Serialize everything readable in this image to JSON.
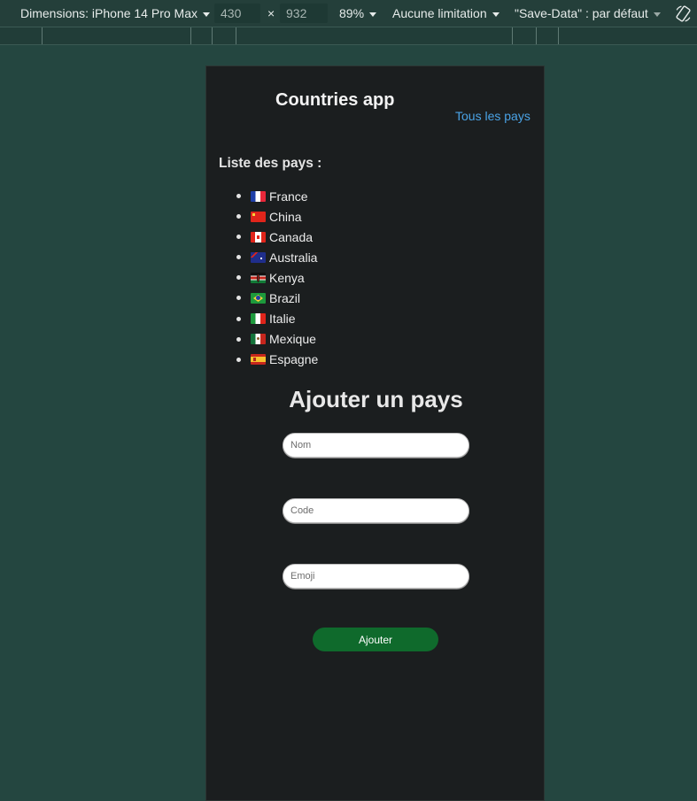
{
  "devtools": {
    "device_label": "Dimensions: iPhone 14 Pro Max",
    "width": "430",
    "times": "×",
    "height": "932",
    "zoom": "89%",
    "throttle": "Aucune limitation",
    "save_data": "\"Save-Data\" : par défaut",
    "rotate_icon": "rotate-icon"
  },
  "app": {
    "title": "Countries app",
    "nav_link": "Tous les pays",
    "list_title": "Liste des pays :",
    "countries": [
      {
        "name": "France",
        "flag": "france-flag-icon"
      },
      {
        "name": "China",
        "flag": "china-flag-icon"
      },
      {
        "name": "Canada",
        "flag": "canada-flag-icon"
      },
      {
        "name": "Australia",
        "flag": "australia-flag-icon"
      },
      {
        "name": "Kenya",
        "flag": "kenya-flag-icon"
      },
      {
        "name": "Brazil",
        "flag": "brazil-flag-icon"
      },
      {
        "name": "Italie",
        "flag": "italy-flag-icon"
      },
      {
        "name": "Mexique",
        "flag": "mexico-flag-icon"
      },
      {
        "name": "Espagne",
        "flag": "spain-flag-icon"
      }
    ],
    "form": {
      "title": "Ajouter un pays",
      "name_placeholder": "Nom",
      "code_placeholder": "Code",
      "emoji_placeholder": "Emoji",
      "submit_label": "Ajouter"
    }
  },
  "colors": {
    "page_bg": "#244640",
    "app_bg": "#1b1e1f",
    "link": "#4aa3e6",
    "button": "#0f6a2c"
  }
}
